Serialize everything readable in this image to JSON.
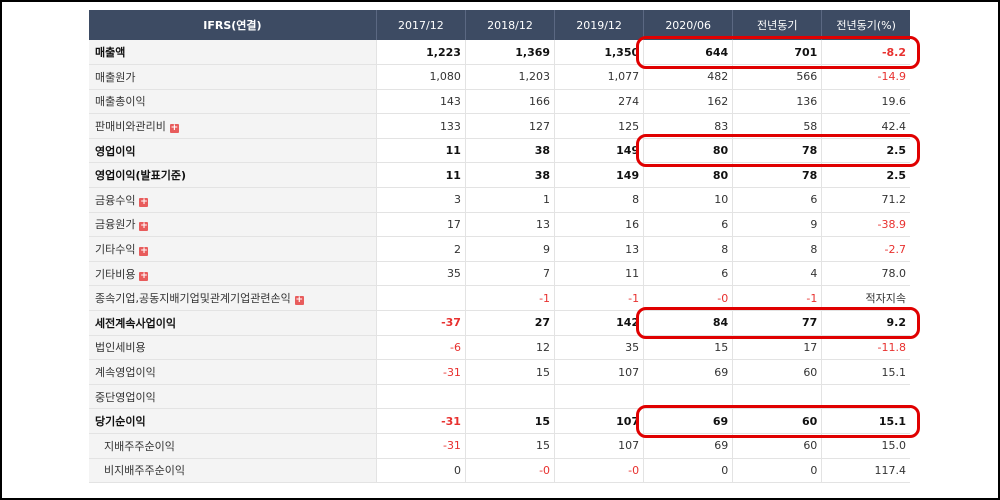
{
  "header": [
    "IFRS(연결)",
    "2017/12",
    "2018/12",
    "2019/12",
    "2020/06",
    "전년동기",
    "전년동기(%)"
  ],
  "rows": [
    {
      "label": "매출액",
      "bold": true,
      "plus": false,
      "indent": false,
      "values": [
        "1,223",
        "1,369",
        "1,350",
        "644",
        "701",
        "-8.2"
      ]
    },
    {
      "label": "매출원가",
      "bold": false,
      "plus": false,
      "indent": false,
      "values": [
        "1,080",
        "1,203",
        "1,077",
        "482",
        "566",
        "-14.9"
      ]
    },
    {
      "label": "매출총이익",
      "bold": false,
      "plus": false,
      "indent": false,
      "values": [
        "143",
        "166",
        "274",
        "162",
        "136",
        "19.6"
      ]
    },
    {
      "label": "판매비와관리비",
      "bold": false,
      "plus": true,
      "indent": false,
      "values": [
        "133",
        "127",
        "125",
        "83",
        "58",
        "42.4"
      ]
    },
    {
      "label": "영업이익",
      "bold": true,
      "plus": false,
      "indent": false,
      "values": [
        "11",
        "38",
        "149",
        "80",
        "78",
        "2.5"
      ]
    },
    {
      "label": "영업이익(발표기준)",
      "bold": true,
      "plus": false,
      "indent": false,
      "values": [
        "11",
        "38",
        "149",
        "80",
        "78",
        "2.5"
      ]
    },
    {
      "label": "금융수익",
      "bold": false,
      "plus": true,
      "indent": false,
      "values": [
        "3",
        "1",
        "8",
        "10",
        "6",
        "71.2"
      ]
    },
    {
      "label": "금융원가",
      "bold": false,
      "plus": true,
      "indent": false,
      "values": [
        "17",
        "13",
        "16",
        "6",
        "9",
        "-38.9"
      ]
    },
    {
      "label": "기타수익",
      "bold": false,
      "plus": true,
      "indent": false,
      "values": [
        "2",
        "9",
        "13",
        "8",
        "8",
        "-2.7"
      ]
    },
    {
      "label": "기타비용",
      "bold": false,
      "plus": true,
      "indent": false,
      "values": [
        "35",
        "7",
        "11",
        "6",
        "4",
        "78.0"
      ]
    },
    {
      "label": "종속기업,공동지배기업및관계기업관련손익",
      "bold": false,
      "plus": true,
      "indent": false,
      "values": [
        "",
        "-1",
        "-1",
        "-0",
        "-1",
        "적자지속"
      ]
    },
    {
      "label": "세전계속사업이익",
      "bold": true,
      "plus": false,
      "indent": false,
      "values": [
        "-37",
        "27",
        "142",
        "84",
        "77",
        "9.2"
      ]
    },
    {
      "label": "법인세비용",
      "bold": false,
      "plus": false,
      "indent": false,
      "values": [
        "-6",
        "12",
        "35",
        "15",
        "17",
        "-11.8"
      ]
    },
    {
      "label": "계속영업이익",
      "bold": false,
      "plus": false,
      "indent": false,
      "values": [
        "-31",
        "15",
        "107",
        "69",
        "60",
        "15.1"
      ]
    },
    {
      "label": "중단영업이익",
      "bold": false,
      "plus": false,
      "indent": false,
      "values": [
        "",
        "",
        "",
        "",
        "",
        ""
      ]
    },
    {
      "label": "당기순이익",
      "bold": true,
      "plus": false,
      "indent": false,
      "values": [
        "-31",
        "15",
        "107",
        "69",
        "60",
        "15.1"
      ]
    },
    {
      "label": "지배주주순이익",
      "bold": false,
      "plus": false,
      "indent": true,
      "values": [
        "-31",
        "15",
        "107",
        "69",
        "60",
        "15.0"
      ]
    },
    {
      "label": "비지배주주순이익",
      "bold": false,
      "plus": false,
      "indent": true,
      "values": [
        "0",
        "-0",
        "-0",
        "0",
        "0",
        "117.4"
      ]
    }
  ],
  "highlighted_rows": [
    "매출액",
    "영업이익",
    "세전계속사업이익",
    "당기순이익"
  ],
  "colors": {
    "header_bg": "#3d4b63",
    "negative": "#e8312f",
    "highlight": "#e00000",
    "plus_icon": "#e85c5c"
  },
  "icons": {
    "expand": "plus-icon"
  }
}
